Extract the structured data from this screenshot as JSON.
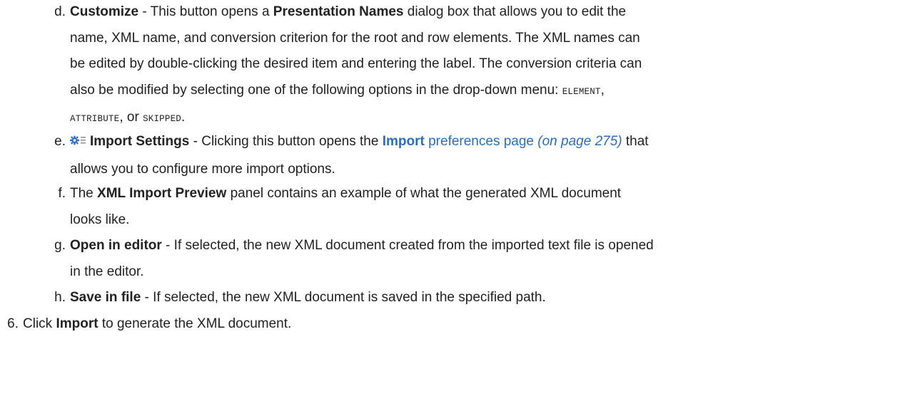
{
  "items": {
    "d": {
      "marker": "d.",
      "term": "Customize",
      "t1": " - This button opens a ",
      "dialog": "Presentation Names",
      "t2": " dialog box that allows you to edit the",
      "line2": "name, XML name, and conversion criterion for the root and row elements. The XML names can",
      "line3": "be edited by double-clicking the desired item and entering the label. The conversion criteria can",
      "line4": "also be modified by selecting one of the following options in the drop-down menu: ",
      "opt1": "ELEMENT",
      "comma": ",",
      "opt2": "ATTRIBUTE",
      "comma2": ", ",
      "or": "or",
      "opt3": "SKIPPED",
      "period": "."
    },
    "e": {
      "marker": "e.",
      "icon": "settings-gear-list-icon",
      "term": "Import Settings",
      "t1": " - Clicking this button opens the ",
      "link_bold": "Import",
      "link_rest": " preferences page",
      "page_ref": "(on page 275)",
      "t2": " that",
      "line2": "allows you to configure more import options."
    },
    "f": {
      "marker": "f.",
      "t0": "The ",
      "term": "XML Import Preview",
      "t1": " panel contains an example of what the generated XML document",
      "line2": "looks like."
    },
    "g": {
      "marker": "g.",
      "term": "Open in editor",
      "t1": " - If selected, the new XML document created from the imported text file is opened",
      "line2": "in the editor."
    },
    "h": {
      "marker": "h.",
      "term": "Save in file",
      "t1": " - If selected, the new XML document is saved in the specified path."
    }
  },
  "step6": {
    "marker": "6.",
    "t0": "Click ",
    "term": "Import",
    "t1": " to generate the XML document."
  },
  "colors": {
    "text": "#222222",
    "link": "#2a6dc4",
    "icon_blue": "#2f6fd0"
  }
}
